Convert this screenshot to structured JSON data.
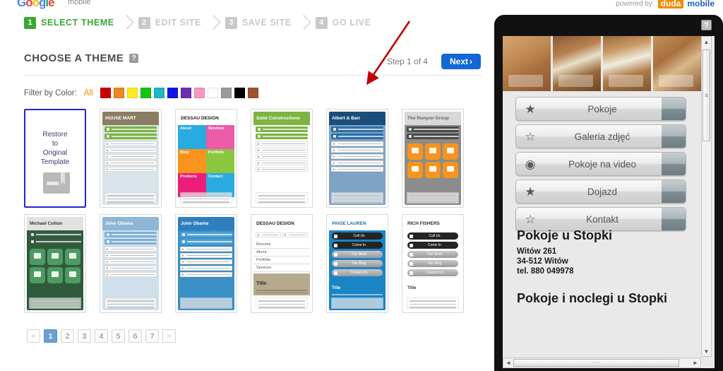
{
  "branding": {
    "logo_letters": [
      "G",
      "o",
      "o",
      "g",
      "l",
      "e"
    ],
    "logo_sub": "mobile",
    "powered_by_text": "powered by:",
    "duda_badge": "duda",
    "duda_mobile": "mobile"
  },
  "steps": [
    {
      "num": "1",
      "label": "SELECT THEME",
      "state": "active"
    },
    {
      "num": "2",
      "label": "EDIT SITE",
      "state": "inactive"
    },
    {
      "num": "3",
      "label": "SAVE SITE",
      "state": "inactive"
    },
    {
      "num": "4",
      "label": "GO LIVE",
      "state": "inactive"
    }
  ],
  "header": {
    "title": "CHOOSE A THEME",
    "help_icon": "?",
    "step_of": "Step 1 of 4",
    "next_label": "Next",
    "next_chevron": "›",
    "next_color": "#1268d4"
  },
  "filter": {
    "label": "Filter by Color:",
    "all_label": "All",
    "swatches": [
      {
        "name": "red",
        "hex": "#cc0000"
      },
      {
        "name": "orange",
        "hex": "#f08722"
      },
      {
        "name": "yellow",
        "hex": "#fcee21"
      },
      {
        "name": "green",
        "hex": "#12c412"
      },
      {
        "name": "teal",
        "hex": "#1fb8c4"
      },
      {
        "name": "blue",
        "hex": "#1414e6"
      },
      {
        "name": "purple",
        "hex": "#6a2fb0"
      },
      {
        "name": "pink",
        "hex": "#f49ac1"
      },
      {
        "name": "white",
        "hex": "#ffffff"
      },
      {
        "name": "gray",
        "hex": "#9a9a9a"
      },
      {
        "name": "black",
        "hex": "#000000"
      },
      {
        "name": "brown",
        "hex": "#a0522d"
      }
    ]
  },
  "themes": {
    "row1": [
      {
        "id": "restore",
        "kind": "restore",
        "title": "Restore to Original Template",
        "selected": true
      },
      {
        "id": "house-mart",
        "kind": "preview",
        "title": "HOUSE MART",
        "head_bg": "#8b7d63",
        "head_fg": "#ffffff",
        "body_bg": "#d8e4ea",
        "accent": "#7cb342",
        "layout": "list"
      },
      {
        "id": "dessau-design-tiles",
        "kind": "preview",
        "title": "DESSAU DESIGN",
        "head_bg": "#ffffff",
        "head_fg": "#1a1a1a",
        "body_bg": "#ffffff",
        "accent": "#29abe2",
        "layout": "quad",
        "quad_labels": [
          "About",
          "Services",
          "Blog",
          "Portfolio",
          "Products",
          "Contact"
        ],
        "quad_colors": [
          "#29abe2",
          "#ec5aa8",
          "#f7941e",
          "#8cc63f",
          "#ec1e79",
          "#29abe2"
        ]
      },
      {
        "id": "solid-constructions",
        "kind": "preview",
        "title": "Solid Constructions",
        "head_bg": "#7cb342",
        "head_fg": "#ffffff",
        "body_bg": "#ffffff",
        "accent": "#7cb342",
        "layout": "list"
      },
      {
        "id": "albert-barr",
        "kind": "preview",
        "title": "Albert & Barr",
        "head_bg": "#1a4e7a",
        "head_fg": "#ffffff",
        "body_bg": "#7fa3c4",
        "accent": "#2b6ea8",
        "layout": "list"
      },
      {
        "id": "runyon-group",
        "kind": "preview",
        "title": "The Runyon Group",
        "head_bg": "#d8d8d8",
        "head_fg": "#666666",
        "body_bg": "#8c8c8c",
        "accent": "#f7941e",
        "layout": "tiles"
      }
    ],
    "row2": [
      {
        "id": "michael-colton",
        "kind": "preview",
        "title": "Michael Colton",
        "head_bg": "#e2e2e2",
        "head_fg": "#333333",
        "body_bg": "#2f5a3c",
        "accent": "#4e9a62",
        "layout": "tiles"
      },
      {
        "id": "john-obama-snow",
        "kind": "preview",
        "title": "John Obama",
        "head_bg": "#8fb6d4",
        "head_fg": "#ffffff",
        "body_bg": "#cfe0ec",
        "accent": "#7fb0d8",
        "layout": "list"
      },
      {
        "id": "john-obama-reef",
        "kind": "preview",
        "title": "John Obama",
        "head_bg": "#2f7fbf",
        "head_fg": "#ffffff",
        "body_bg": "#3a8fc4",
        "accent": "#4ba0d4",
        "layout": "list"
      },
      {
        "id": "dessau-design-resume",
        "kind": "preview",
        "title": "DESSAU DESIGN",
        "head_bg": "#ffffff",
        "head_fg": "#1a1a1a",
        "body_bg": "#ffffff",
        "accent": "#b5a98e",
        "layout": "resume",
        "resume_items": [
          "Resume",
          "About",
          "Portfolio",
          "Services"
        ],
        "resume_title": "Title"
      },
      {
        "id": "paige-lauren",
        "kind": "preview",
        "title": "PAIGE LAUREN",
        "head_bg": "#ffffff",
        "head_fg": "#1b6fa8",
        "body_bg": "#1b84c4",
        "accent": "#2b2b2b",
        "layout": "darkbars",
        "darkbars": [
          "Call Us",
          "Come In",
          "Our Work",
          "Our Blog",
          "Contact Us"
        ],
        "foot_title": "Title"
      },
      {
        "id": "rich-fishers",
        "kind": "preview",
        "title": "RICH FISHERS",
        "head_bg": "#ffffff",
        "head_fg": "#2b2b2b",
        "body_bg": "#ffffff",
        "accent": "#2b2b2b",
        "layout": "darkbars",
        "darkbars": [
          "Call Us",
          "Come In",
          "Our Work",
          "Our Blog",
          "Contact Us"
        ],
        "foot_title": "Title"
      }
    ]
  },
  "pagination": {
    "prev": "<",
    "next": ">",
    "pages": [
      "1",
      "2",
      "3",
      "4",
      "5",
      "6",
      "7"
    ],
    "current": "1"
  },
  "annotation": {
    "type": "red-arrow",
    "color": "#c00000"
  },
  "phone": {
    "help_icon": "?",
    "photos": [
      {
        "name": "wooden-room-bed"
      },
      {
        "name": "wooden-room-window"
      },
      {
        "name": "wooden-room-twin-beds"
      },
      {
        "name": "wooden-room-table"
      }
    ],
    "menu": [
      {
        "label": "Pokoje",
        "icon": "★",
        "icon_name": "star-filled-icon"
      },
      {
        "label": "Galeria zdjęć",
        "icon": "☆",
        "icon_name": "star-outline-icon"
      },
      {
        "label": "Pokoje na video",
        "icon": "◉",
        "icon_name": "film-reel-icon"
      },
      {
        "label": "Dojazd",
        "icon": "★",
        "icon_name": "star-filled-icon"
      },
      {
        "label": "Kontakt",
        "icon": "☆",
        "icon_name": "star-outline-icon"
      }
    ],
    "contact": {
      "business_name": "Pokoje u Stopki",
      "address_line1": "Witów 261",
      "address_line2": "34-512 Witów",
      "phone": "tel. 880 049978",
      "heading2": "Pokoje i noclegi u Stopki"
    },
    "scroll": {
      "up": "▲",
      "down": "▼",
      "left": "◄",
      "right": "►",
      "grip": "≡"
    }
  }
}
